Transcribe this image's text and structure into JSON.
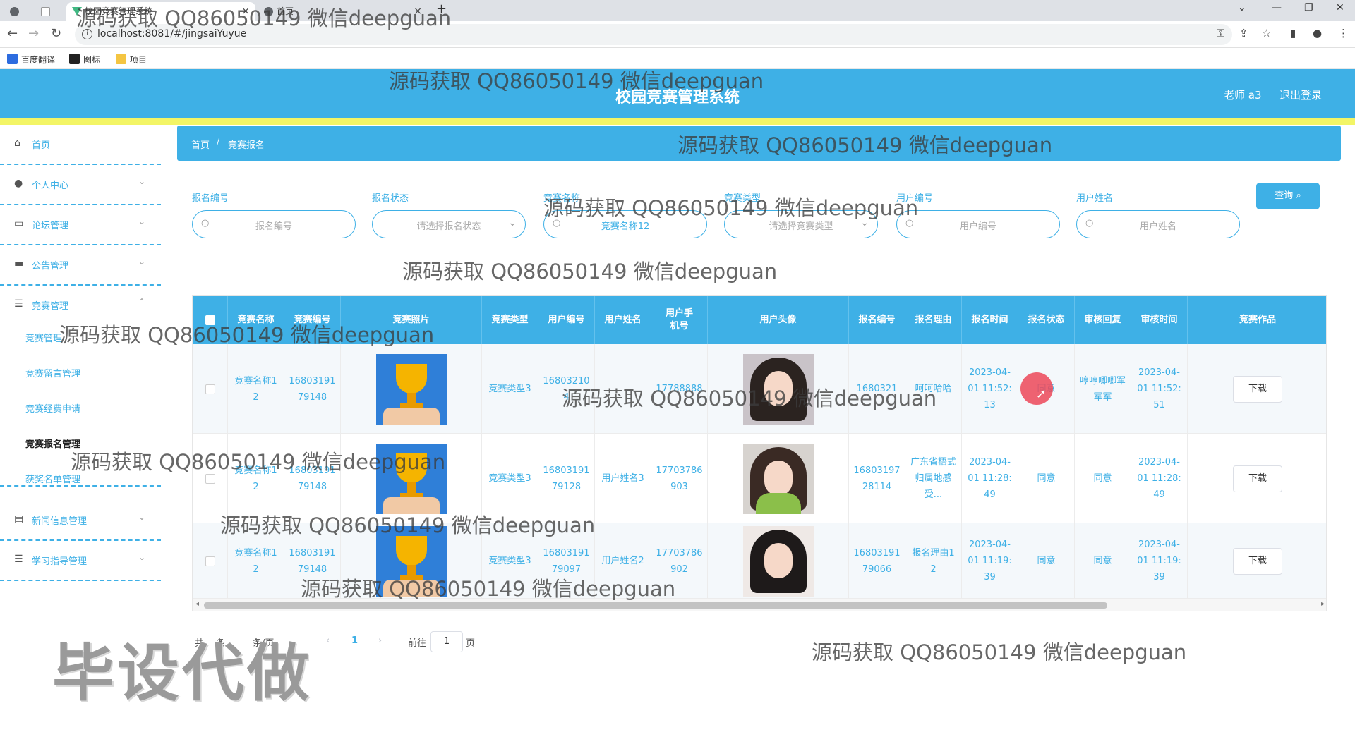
{
  "browser": {
    "tabs": [
      {
        "title": ""
      },
      {
        "title": ""
      },
      {
        "title": "校园竞赛管理系统"
      },
      {
        "title": "首页"
      }
    ],
    "url": "localhost:8081/#/jingsaiYuyue",
    "bookmarks": [
      "百度翻译",
      "图标",
      "项目"
    ]
  },
  "header": {
    "title": "校园竞赛管理系统",
    "user": "老师 a3",
    "logout": "退出登录"
  },
  "sidebar": {
    "items": [
      {
        "label": "首页",
        "icon": "home-icon"
      },
      {
        "label": "个人中心",
        "icon": "user-icon"
      },
      {
        "label": "论坛管理",
        "icon": "forum-icon"
      },
      {
        "label": "公告管理",
        "icon": "notice-icon"
      },
      {
        "label": "竞赛管理",
        "icon": "list-icon"
      },
      {
        "label": "新闻信息管理",
        "icon": "news-icon"
      },
      {
        "label": "学习指导管理",
        "icon": "guide-icon"
      }
    ],
    "sub": [
      "竞赛管理",
      "竞赛留言管理",
      "竞赛经费申请",
      "竞赛报名管理",
      "获奖名单管理"
    ]
  },
  "breadcrumb": {
    "home": "首页",
    "sep": "/",
    "current": "竞赛报名"
  },
  "search": {
    "fields": [
      {
        "label": "报名编号",
        "placeholder": "报名编号",
        "value": ""
      },
      {
        "label": "报名状态",
        "placeholder": "请选择报名状态",
        "value": ""
      },
      {
        "label": "竞赛名称",
        "placeholder": "竞赛名称",
        "value": "竞赛名称12"
      },
      {
        "label": "竞赛类型",
        "placeholder": "请选择竞赛类型",
        "value": ""
      },
      {
        "label": "用户编号",
        "placeholder": "用户编号",
        "value": ""
      },
      {
        "label": "用户姓名",
        "placeholder": "用户姓名",
        "value": ""
      }
    ],
    "query_label": "查询",
    "query_icon": "search-icon"
  },
  "table": {
    "columns": [
      "竞赛名称",
      "竞赛编号",
      "竞赛照片",
      "竞赛类型",
      "用户编号",
      "用户姓名",
      "用户手机号",
      "用户头像",
      "报名编号",
      "报名理由",
      "报名时间",
      "报名状态",
      "审核回复",
      "审核时间",
      "竞赛作品"
    ],
    "rows": [
      {
        "name": "竞赛名称12",
        "code": "1680319179148",
        "type": "竞赛类型3",
        "user_no": "168032104",
        "user_name": "",
        "phone": "17788888",
        "apply_no": "1680321",
        "reason": "呵呵哈哈",
        "apply_time": "2023-04-01 11:52:13",
        "status": "同意",
        "reply": "哼哼唧唧军军军",
        "review_time": "2023-04-01 11:52:51",
        "action": "下载",
        "avatar_color": "#2b2320"
      },
      {
        "name": "竞赛名称12",
        "code": "1680319179148",
        "type": "竞赛类型3",
        "user_no": "1680319179128",
        "user_name": "用户姓名3",
        "phone": "17703786903",
        "apply_no": "1680319728114",
        "reason": "广东省梧式归属地感受...",
        "apply_time": "2023-04-01 11:28:49",
        "status": "同意",
        "reply": "同意",
        "review_time": "2023-04-01 11:28:49",
        "action": "下载",
        "avatar_color": "#3a2a24"
      },
      {
        "name": "竞赛名称12",
        "code": "1680319179148",
        "type": "竞赛类型3",
        "user_no": "1680319179097",
        "user_name": "用户姓名2",
        "phone": "17703786902",
        "apply_no": "1680319179066",
        "reason": "报名理由12",
        "apply_time": "2023-04-01 11:19:39",
        "status": "同意",
        "reply": "同意",
        "review_time": "2023-04-01 11:19:39",
        "action": "下载",
        "avatar_color": "#1e1a1a"
      }
    ]
  },
  "pagination": {
    "total_prefix": "共",
    "total_suffix": "条",
    "per_page": "条/页",
    "current_page": "1",
    "prev": "‹",
    "next": "›",
    "goto": "前往",
    "page_unit": "页"
  },
  "watermarks": {
    "text": "源码获取 QQ86050149 微信deepguan",
    "big": "毕设代做"
  }
}
